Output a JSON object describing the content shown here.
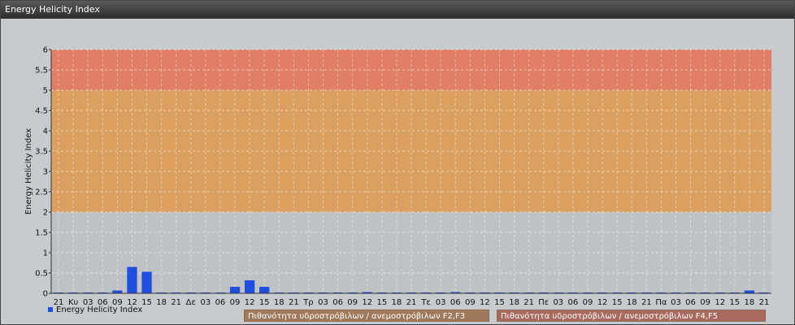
{
  "window": {
    "title": "Energy Helicity Index"
  },
  "colors": {
    "series": "#1f4fe0",
    "band_mid": "#dba05f",
    "band_high": "#e07e66",
    "band_low": "#bfc2c5"
  },
  "chart_data": {
    "type": "bar",
    "ylabel": "Energy Helicity Index",
    "ylim": [
      0,
      6
    ],
    "yticks": [
      "0",
      "0.5",
      "1",
      "1.5",
      "2",
      "2.5",
      "3",
      "3.5",
      "4",
      "4.5",
      "5",
      "5.5",
      "6"
    ],
    "bands": [
      {
        "from": 2,
        "to": 5,
        "label": "Πιθανότητα υδροστρόβιλων / ανεμοστρόβιλων F2,F3",
        "color": "#dba05f"
      },
      {
        "from": 5,
        "to": 6,
        "label": "Πιθανότητα υδροστρόβιλων / ανεμοστρόβιλων F4,F5",
        "color": "#e07e66"
      }
    ],
    "categories": [
      "21",
      "Κυ",
      "03",
      "06",
      "09",
      "12",
      "15",
      "18",
      "21",
      "Δε",
      "03",
      "06",
      "09",
      "12",
      "15",
      "18",
      "21",
      "Τρ",
      "03",
      "06",
      "09",
      "12",
      "15",
      "18",
      "21",
      "Τε",
      "03",
      "06",
      "09",
      "12",
      "15",
      "18",
      "21",
      "Πε",
      "03",
      "06",
      "09",
      "12",
      "15",
      "18",
      "21",
      "Πα",
      "03",
      "06",
      "09",
      "12",
      "15",
      "18",
      "21"
    ],
    "series": [
      {
        "name": "Energy Helicity Index",
        "values": [
          0.02,
          0.02,
          0.02,
          0.02,
          0.07,
          0.65,
          0.53,
          0.02,
          0.02,
          0.02,
          0.02,
          0.02,
          0.16,
          0.32,
          0.16,
          0.02,
          0.02,
          0.02,
          0.02,
          0.02,
          0.02,
          0.03,
          0.02,
          0.02,
          0.02,
          0.02,
          0.02,
          0.03,
          0.02,
          0.02,
          0.02,
          0.02,
          0.02,
          0.02,
          0.02,
          0.02,
          0.02,
          0.02,
          0.02,
          0.02,
          0.02,
          0.02,
          0.02,
          0.02,
          0.02,
          0.02,
          0.02,
          0.07,
          0.02
        ]
      }
    ],
    "legend": "bottom-left",
    "grid": true
  }
}
